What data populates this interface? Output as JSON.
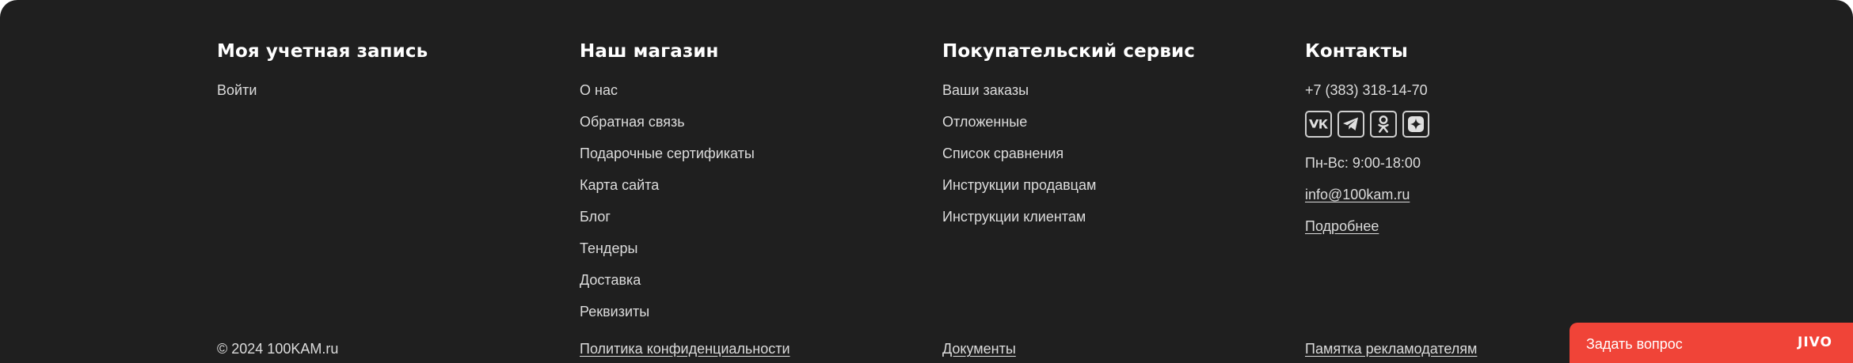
{
  "columns": [
    {
      "title": "Моя учетная запись",
      "links": [
        "Войти"
      ]
    },
    {
      "title": "Наш магазин",
      "links": [
        "О нас",
        "Обратная связь",
        "Подарочные сертификаты",
        "Карта сайта",
        "Блог",
        "Тендеры",
        "Доставка",
        "Реквизиты"
      ]
    },
    {
      "title": "Покупательский сервис",
      "links": [
        "Ваши заказы",
        "Отложенные",
        "Список сравнения",
        "Инструкции продавцам",
        "Инструкции клиентам"
      ]
    }
  ],
  "contacts": {
    "title": "Контакты",
    "phone": "+7 (383) 318-14-70",
    "social": [
      "vk-icon",
      "telegram-icon",
      "odnoklassniki-icon",
      "yandex-zen-icon"
    ],
    "hours": "Пн-Вс: 9:00-18:00",
    "email": "info@100kam.ru",
    "more": "Подробнее"
  },
  "bottom": {
    "copyright": "© 2024 100KAM.ru",
    "privacy": "Политика конфиденциальности",
    "documents": "Документы",
    "advertisers": "Памятка рекламодателям"
  },
  "chat": {
    "label": "Задать вопрос",
    "brand": "JIVO",
    "color": "#f04438"
  },
  "colors": {
    "background": "#1f1f1f",
    "text": "#dcdcdc",
    "heading": "#ffffff"
  }
}
